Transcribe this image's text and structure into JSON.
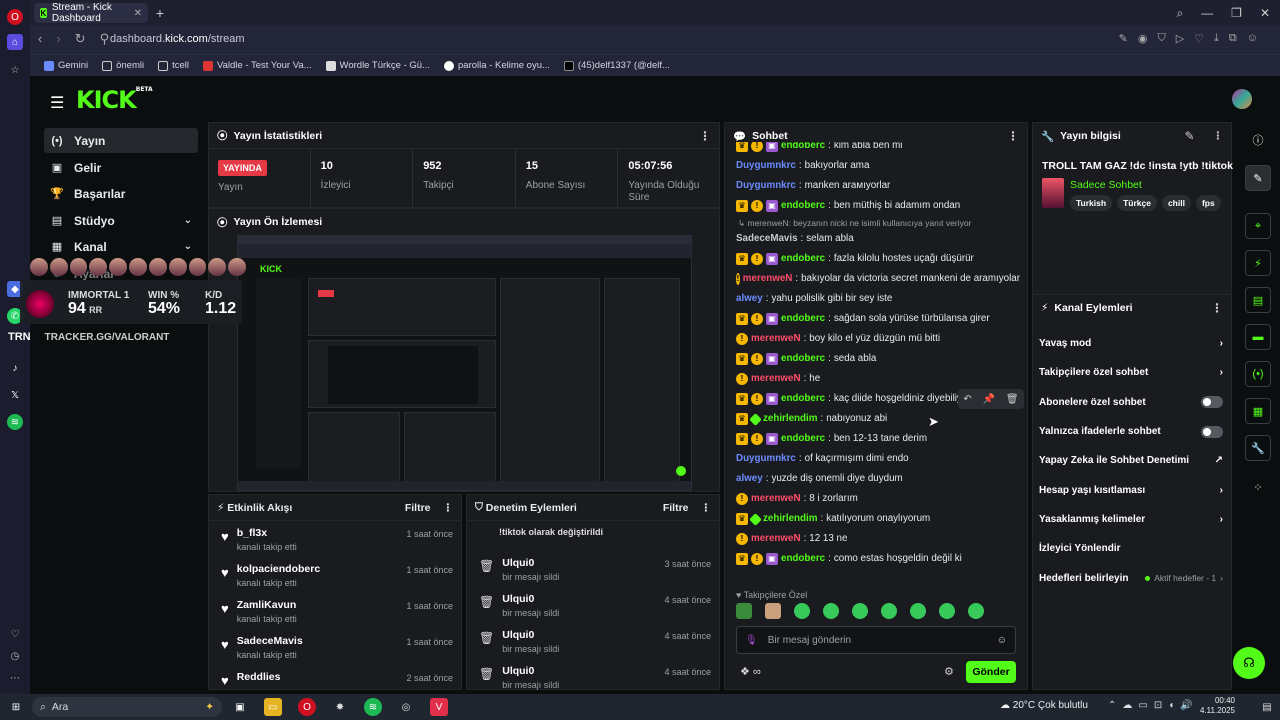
{
  "browser": {
    "tab_title": "Stream - Kick Dashboard",
    "url_prefix": "dashboard.",
    "url_domain": "kick.com",
    "url_path": "/stream",
    "bookmarks": [
      "Gemini",
      "önemli",
      "tcell",
      "Valdle - Test Your Va...",
      "Wordle Türkçe - Gü...",
      "parolla - Kelime oyu...",
      "(45)delf1337 (@delf..."
    ]
  },
  "header": {
    "logo": "KICK",
    "logo_tag": "BETA"
  },
  "sidebar": [
    {
      "label": "Yayın",
      "icon": "(•)"
    },
    {
      "label": "Gelir",
      "icon": "▣"
    },
    {
      "label": "Başarılar",
      "icon": "🏆"
    },
    {
      "label": "Stüdyo",
      "icon": "▤"
    },
    {
      "label": "Kanal",
      "icon": "▦"
    },
    {
      "label": "Ayarlar",
      "icon": "⚙"
    }
  ],
  "stats": {
    "title": "Yayın İstatistikleri",
    "live_badge": "YAYINDA",
    "items": [
      {
        "value": "",
        "label": "Yayın"
      },
      {
        "value": "10",
        "label": "İzleyici"
      },
      {
        "value": "952",
        "label": "Takipçi"
      },
      {
        "value": "15",
        "label": "Abone Sayısı"
      },
      {
        "value": "05:07:56",
        "label": "Yayında Olduğu Süre"
      }
    ]
  },
  "preview": {
    "title": "Yayın Ön İzlemesi"
  },
  "activity": {
    "title": "Etkinlik Akışı",
    "filter": "Filtre",
    "rows": [
      {
        "name": "b_fl3x",
        "sub": "kanalı takip etti",
        "time": "1 saat önce"
      },
      {
        "name": "kolpaciendoberc",
        "sub": "kanalı takip etti",
        "time": "1 saat önce"
      },
      {
        "name": "ZamliKavun",
        "sub": "kanalı takip etti",
        "time": "1 saat önce"
      },
      {
        "name": "SadeceMavis",
        "sub": "kanalı takip etti",
        "time": "1 saat önce"
      },
      {
        "name": "Reddlies",
        "sub": "",
        "time": "2 saat önce"
      }
    ]
  },
  "moderation": {
    "title": "Denetim Eylemleri",
    "filter": "Filtre",
    "top_partial": "!tiktok olarak değiştirildi",
    "rows": [
      {
        "name": "Ulqui0",
        "sub": "bir mesajı sildi",
        "time": "3 saat önce"
      },
      {
        "name": "Ulqui0",
        "sub": "bir mesajı sildi",
        "time": "4 saat önce"
      },
      {
        "name": "Ulqui0",
        "sub": "bir mesajı sildi",
        "time": "4 saat önce"
      },
      {
        "name": "Ulqui0",
        "sub": "bir mesajı sildi",
        "time": "4 saat önce"
      }
    ]
  },
  "chat": {
    "title": "Sohbet",
    "messages": [
      {
        "user": "endoberc",
        "color": "#53fc18",
        "badges": [
          "crown",
          "sub",
          "gift"
        ],
        "text": "kim abla ben mi"
      },
      {
        "user": "Duygumnkrc",
        "color": "#6b8cff",
        "badges": [],
        "text": "bakıyorlar ama"
      },
      {
        "user": "Duygumnkrc",
        "color": "#6b8cff",
        "badges": [],
        "text": "manken arамıyorlar"
      },
      {
        "user": "endoberc",
        "color": "#53fc18",
        "badges": [
          "crown",
          "sub",
          "gift"
        ],
        "text": "ben müthiş bi adamım ondan"
      },
      {
        "reply": "↳ merenweN: beyzanın nicki ne isimli kullanıcıya yanıt veriyor",
        "user": "SadeceMavis",
        "color": "#c5c8cc",
        "badges": [],
        "text": "selam abla"
      },
      {
        "user": "endoberc",
        "color": "#53fc18",
        "badges": [
          "crown",
          "sub",
          "gift"
        ],
        "text": "fazla kilolu hostes uçağı düşürür"
      },
      {
        "user": "merenweN",
        "color": "#ff4d6a",
        "badges": [
          "sub"
        ],
        "text": "bakıyolar da victoria secret mankeni de aramıyolar"
      },
      {
        "user": "alwey",
        "color": "#6b8cff",
        "badges": [],
        "text": "yahu polislik gibi bir sey iste"
      },
      {
        "user": "endoberc",
        "color": "#53fc18",
        "badges": [
          "crown",
          "sub",
          "gift"
        ],
        "text": "sağdan sola yürüse türbülansa girer"
      },
      {
        "user": "merenweN",
        "color": "#ff4d6a",
        "badges": [
          "sub"
        ],
        "text": "boy kilo el yüz düzgün mü bitti"
      },
      {
        "user": "endoberc",
        "color": "#53fc18",
        "badges": [
          "crown",
          "sub",
          "gift"
        ],
        "text": "seda abla"
      },
      {
        "user": "merenweN",
        "color": "#ff4d6a",
        "badges": [
          "sub"
        ],
        "text": "he"
      },
      {
        "user": "endoberc",
        "color": "#53fc18",
        "badges": [
          "crown",
          "sub",
          "gift"
        ],
        "text": "kaç diide hoşgeldiniz diyebiliyon"
      },
      {
        "user": "zehirlendim",
        "color": "#53fc18",
        "badges": [
          "crown",
          "v"
        ],
        "text": "nabıyonuz abi"
      },
      {
        "user": "endoberc",
        "color": "#53fc18",
        "badges": [
          "crown",
          "sub",
          "gift"
        ],
        "text": "ben 12-13 tane derim"
      },
      {
        "user": "Duygumnkrc",
        "color": "#6b8cff",
        "badges": [],
        "text": "of kaçırmışım dimi endo"
      },
      {
        "user": "alwey",
        "color": "#6b8cff",
        "badges": [],
        "text": "yuzde diş onemli diye duydum"
      },
      {
        "user": "merenweN",
        "color": "#ff4d6a",
        "badges": [
          "sub"
        ],
        "text": "8 i zorlarım"
      },
      {
        "user": "zehirlendim",
        "color": "#53fc18",
        "badges": [
          "crown",
          "v"
        ],
        "text": "katılıyorum onaylıyorum"
      },
      {
        "user": "merenweN",
        "color": "#ff4d6a",
        "badges": [
          "sub"
        ],
        "text": "12 13 ne"
      },
      {
        "user": "endoberc",
        "color": "#53fc18",
        "badges": [
          "crown",
          "sub",
          "gift"
        ],
        "text": "como estas hoşgeldin değil ki"
      }
    ],
    "followers_label": "♥ Takipçilere Özel",
    "input_placeholder": "Bir mesaj gönderin",
    "send_label": "Gönder"
  },
  "stream_info": {
    "title": "Yayın bilgisi",
    "stream_title": "TROLL TAM GAZ !dc !insta !ytb !tiktok",
    "category": "Sadece Sohbet",
    "tags": [
      "Turkish",
      "Türkçe",
      "chill",
      "fps"
    ]
  },
  "channel_actions": {
    "title": "Kanal Eylemleri",
    "items": [
      {
        "label": "Yavaş mod",
        "kind": "chevron"
      },
      {
        "label": "Takipçilere özel sohbet",
        "kind": "chevron"
      },
      {
        "label": "Abonelere özel sohbet",
        "kind": "toggle"
      },
      {
        "label": "Yalnızca ifadelerle sohbet",
        "kind": "toggle"
      },
      {
        "label": "Yapay Zeka ile Sohbet Denetimi",
        "kind": "ext"
      },
      {
        "label": "Hesap yaşı kısıtlaması",
        "kind": "chevron"
      },
      {
        "label": "Yasaklanmış kelimeler",
        "kind": "chevron"
      },
      {
        "label": "İzleyici Yönlendir",
        "kind": "none"
      },
      {
        "label": "Hedefleri belirleyin",
        "kind": "meta",
        "meta": "Aktif hedefler - 1"
      }
    ]
  },
  "overlay": {
    "rank": "IMMORTAL 1",
    "rr": "94",
    "rr_unit": "RR",
    "win_label": "WIN %",
    "win": "54%",
    "kd_label": "K/D",
    "kd": "1.12",
    "trn": "TRN",
    "tracker": "TRACKER.GG/VALORANT"
  },
  "taskbar": {
    "search": "Ara",
    "weather_temp": "20°C",
    "weather_text": "Çok bulutlu",
    "time": "00:40",
    "date": "4.11.2025"
  },
  "colors": {
    "brand": "#53fc18",
    "live": "#e63946"
  }
}
